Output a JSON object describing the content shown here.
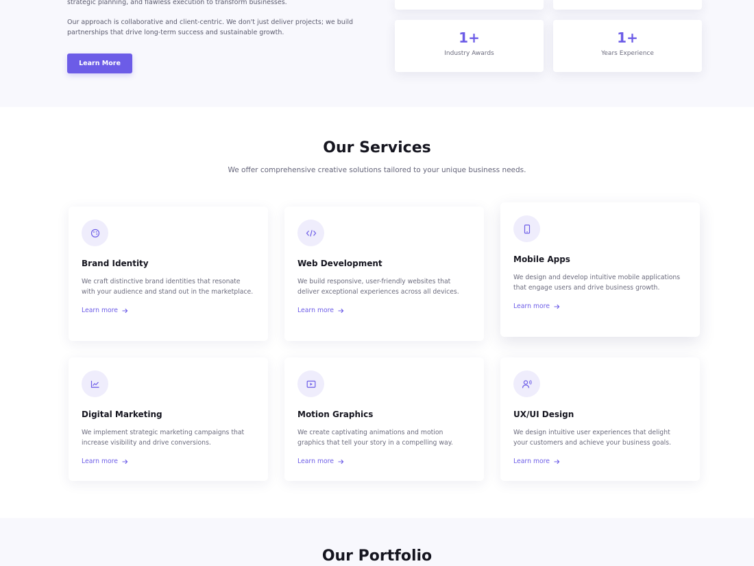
{
  "about": {
    "paragraph_1": "strategic planning, and flawless execution to transform businesses.",
    "paragraph_2": "Our approach is collaborative and client-centric. We don't just deliver projects; we build partnerships that drive long-term success and sustainable growth.",
    "cta_label": "Learn More",
    "stats": [
      {
        "value": "1+",
        "label": "Industry Awards"
      },
      {
        "value": "1+",
        "label": "Years Experience"
      }
    ]
  },
  "services": {
    "title": "Our Services",
    "subtitle": "We offer comprehensive creative solutions tailored to your unique business needs.",
    "items": [
      {
        "icon": "palette-icon",
        "title": "Brand Identity",
        "description": "We craft distinctive brand identities that resonate with your audience and stand out in the marketplace.",
        "link": "Learn more"
      },
      {
        "icon": "code-icon",
        "title": "Web Development",
        "description": "We build responsive, user-friendly websites that deliver exceptional experiences across all devices.",
        "link": "Learn more"
      },
      {
        "icon": "mobile-icon",
        "title": "Mobile Apps",
        "description": "We design and develop intuitive mobile applications that engage users and drive business growth.",
        "link": "Learn more"
      },
      {
        "icon": "chart-icon",
        "title": "Digital Marketing",
        "description": "We implement strategic marketing campaigns that increase visibility and drive conversions.",
        "link": "Learn more"
      },
      {
        "icon": "video-icon",
        "title": "Motion Graphics",
        "description": "We create captivating animations and motion graphics that tell your story in a compelling way.",
        "link": "Learn more"
      },
      {
        "icon": "user-voice-icon",
        "title": "UX/UI Design",
        "description": "We design intuitive user experiences that delight your customers and achieve your business goals.",
        "link": "Learn more"
      }
    ]
  },
  "portfolio": {
    "title": "Our Portfolio"
  },
  "colors": {
    "accent": "#6c5ce7",
    "icon_bg": "#efedfc",
    "section_bg": "#f8f8fd"
  }
}
